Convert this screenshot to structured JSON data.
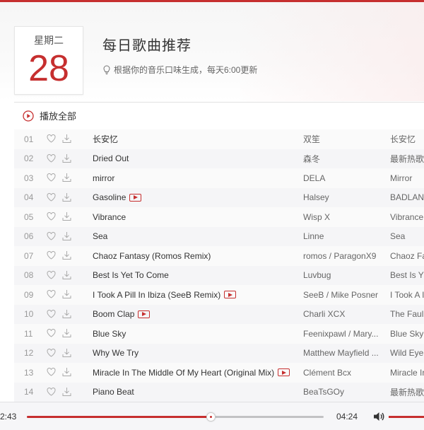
{
  "header": {
    "weekday": "星期二",
    "day": "28",
    "title": "每日歌曲推荐",
    "subtitle": "根据你的音乐口味生成，每天6:00更新"
  },
  "play_all": {
    "label": "播放全部"
  },
  "accent_color": "#c62f2f",
  "songs": [
    {
      "idx": "01",
      "title": "长安忆",
      "artist": "双笙",
      "album": "长安忆",
      "mv": false
    },
    {
      "idx": "02",
      "title": "Dried Out",
      "artist": "森冬",
      "album": "最新热歌",
      "mv": false
    },
    {
      "idx": "03",
      "title": "mirror",
      "artist": "DELA",
      "album": "Mirror",
      "mv": false
    },
    {
      "idx": "04",
      "title": "Gasoline",
      "artist": "Halsey",
      "album": "BADLANDS",
      "mv": true
    },
    {
      "idx": "05",
      "title": "Vibrance",
      "artist": "Wisp X",
      "album": "Vibrance",
      "mv": false
    },
    {
      "idx": "06",
      "title": "Sea",
      "artist": "Linne",
      "album": "Sea",
      "mv": false
    },
    {
      "idx": "07",
      "title": "Chaoz Fantasy (Romos Remix)",
      "artist": "romos / ParagonX9",
      "album": "Chaoz Fa",
      "mv": false
    },
    {
      "idx": "08",
      "title": "Best Is Yet To Come",
      "artist": "Luvbug",
      "album": "Best Is Y",
      "mv": false
    },
    {
      "idx": "09",
      "title": "I Took A Pill In Ibiza (SeeB Remix)",
      "artist": "SeeB / Mike Posner",
      "album": "I Took A I",
      "mv": true
    },
    {
      "idx": "10",
      "title": "Boom Clap",
      "artist": "Charli XCX",
      "album": "The Faul",
      "mv": true
    },
    {
      "idx": "11",
      "title": "Blue Sky",
      "artist": "Feenixpawl / Mary...",
      "album": "Blue Sky",
      "mv": false
    },
    {
      "idx": "12",
      "title": "Why We Try",
      "artist": "Matthew Mayfield ...",
      "album": "Wild Eye",
      "mv": false
    },
    {
      "idx": "13",
      "title": "Miracle In The Middle Of My Heart (Original Mix)",
      "artist": "Clément Bcx",
      "album": "Miracle Ir",
      "mv": true
    },
    {
      "idx": "14",
      "title": "Piano Beat",
      "artist": "BeaTsGOy",
      "album": "最新热歌",
      "mv": false
    }
  ],
  "player": {
    "current_time": "2:43",
    "total_time": "04:24",
    "progress_fraction": 0.62,
    "volume_icon": "speaker-icon"
  }
}
